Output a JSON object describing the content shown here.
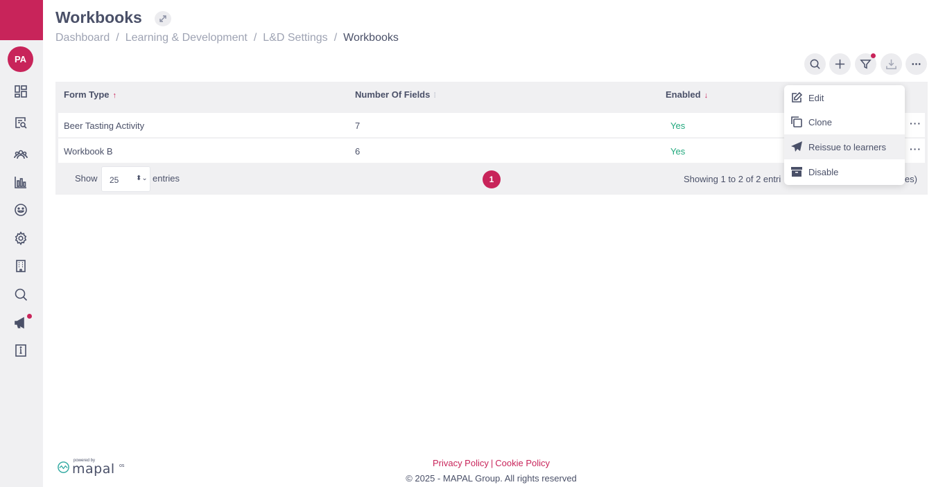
{
  "sidebar": {
    "avatar_initials": "PA",
    "icons": [
      "dashboard-icon",
      "document-search-icon",
      "people-icon",
      "bar-chart-icon",
      "smiley-icon",
      "gear-icon",
      "building-icon",
      "search-icon",
      "megaphone-icon",
      "info-icon"
    ]
  },
  "header": {
    "title": "Workbooks",
    "breadcrumb": [
      "Dashboard",
      "Learning & Development",
      "L&D Settings",
      "Workbooks"
    ],
    "separator": "/"
  },
  "toolbar": {
    "buttons": [
      "search-icon",
      "plus-icon",
      "filter-icon",
      "download-icon",
      "more-icon"
    ]
  },
  "table": {
    "columns": [
      {
        "label": "Form Type",
        "sort": "↑"
      },
      {
        "label": "Number Of Fields",
        "sort": "⁞"
      },
      {
        "label": "Enabled",
        "sort": "↓"
      }
    ],
    "rows": [
      {
        "form_type": "Beer Tasting Activity",
        "fields": "7",
        "enabled": "Yes"
      },
      {
        "form_type": "Workbook B",
        "fields": "6",
        "enabled": "Yes"
      }
    ],
    "more_label": "···",
    "show_label": "Show",
    "page_size": "25",
    "entries_label": "entries",
    "current_page": "1",
    "showing_text": "Showing 1 to 2 of 2 entri",
    "showing_tail": "ies)"
  },
  "dropdown": {
    "items": [
      {
        "label": "Edit",
        "icon": "edit-icon"
      },
      {
        "label": "Clone",
        "icon": "clone-icon"
      },
      {
        "label": "Reissue to learners",
        "icon": "send-icon"
      },
      {
        "label": "Disable",
        "icon": "archive-icon"
      }
    ]
  },
  "footer": {
    "powered_by": "powered by",
    "logo": "mapal",
    "logo_suffix": "os",
    "privacy": "Privacy Policy",
    "divider": "|",
    "cookie": "Cookie Policy",
    "copyright": "© 2025 - MAPAL Group. All rights reserved"
  },
  "colors": {
    "brand": "#c8245a",
    "text": "#4a5068",
    "enabled_yes": "#21a87d",
    "panel_bg": "#f0f0f2"
  }
}
